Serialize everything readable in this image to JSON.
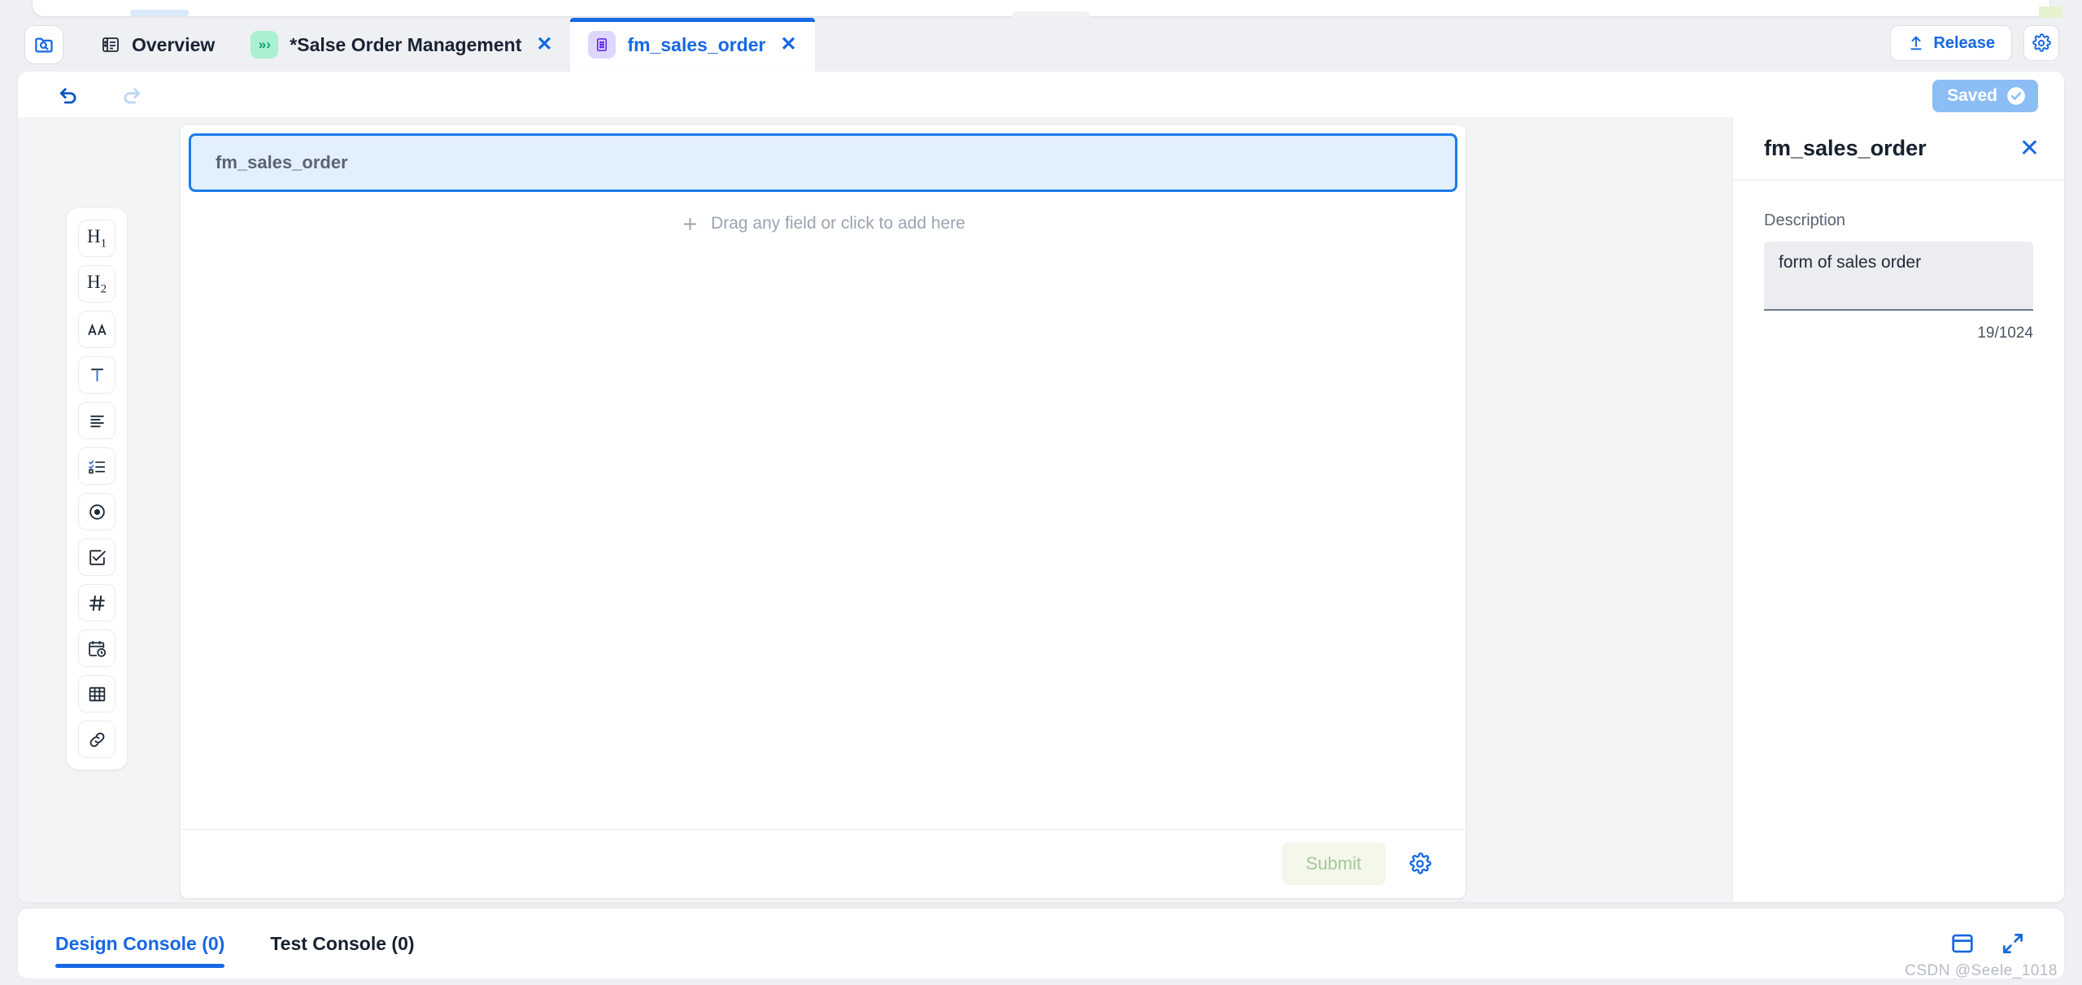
{
  "tabbar": {
    "home_icon": "folder-search-icon",
    "tabs": [
      {
        "label": "Overview",
        "icon": "document-list-icon",
        "active": false,
        "closable": false
      },
      {
        "label": "*Salse Order Management",
        "icon": "chevrons-right-icon",
        "active": false,
        "closable": true,
        "close_label": "✕"
      },
      {
        "label": "fm_sales_order",
        "icon": "form-icon",
        "active": true,
        "closable": true,
        "close_label": "✕"
      }
    ],
    "release_label": "Release",
    "settings_icon": "gear-icon"
  },
  "subtoolbar": {
    "undo_icon": "undo-arrow-icon",
    "redo_icon": "redo-arrow-icon",
    "saved_label": "Saved",
    "saved_check_icon": "check-circle-icon"
  },
  "widgets": [
    {
      "name": "heading-1",
      "kind": "h",
      "text": "H",
      "sub": "1"
    },
    {
      "name": "heading-2",
      "kind": "h",
      "text": "H",
      "sub": "2"
    },
    {
      "name": "font-style",
      "kind": "icon",
      "icon": "font-aa-icon"
    },
    {
      "name": "text-field",
      "kind": "icon",
      "icon": "text-t-icon"
    },
    {
      "name": "paragraph",
      "kind": "icon",
      "icon": "paragraph-lines-icon"
    },
    {
      "name": "checklist",
      "kind": "icon",
      "icon": "checklist-icon"
    },
    {
      "name": "radio-group",
      "kind": "icon",
      "icon": "radio-button-icon"
    },
    {
      "name": "checkbox",
      "kind": "icon",
      "icon": "checkbox-icon"
    },
    {
      "name": "number-field",
      "kind": "icon",
      "icon": "hash-number-icon"
    },
    {
      "name": "date-time",
      "kind": "icon",
      "icon": "calendar-clock-icon"
    },
    {
      "name": "table",
      "kind": "icon",
      "icon": "table-grid-icon"
    },
    {
      "name": "link",
      "kind": "icon",
      "icon": "link-chain-icon"
    }
  ],
  "form": {
    "header_title": "fm_sales_order",
    "dropzone_text": "Drag any field or click to add here",
    "dropzone_icon": "plus-icon",
    "submit_label": "Submit",
    "footer_settings_icon": "gear-icon"
  },
  "props": {
    "title": "fm_sales_order",
    "close_label": "✕",
    "description_label": "Description",
    "description_value": "form of sales order",
    "description_placeholder": "",
    "char_count": "19/1024"
  },
  "console": {
    "tabs": [
      {
        "label": "Design Console (0)",
        "active": true
      },
      {
        "label": "Test Console (0)",
        "active": false
      }
    ],
    "panel_icon": "panel-layout-icon",
    "expand_icon": "expand-fullscreen-icon"
  },
  "watermark": "CSDN @Seele_1018",
  "colors": {
    "accent": "#1668e3",
    "page_bg": "#eef0f3",
    "canvas_bg": "#f3f4f6",
    "header_fill": "#e2f0fd",
    "header_border": "#1a7bea",
    "saved_bg": "#8cbdf5",
    "submit_bg": "#f3f8ea",
    "submit_fg": "#a9c59c",
    "badge_green": "#aaf0d1",
    "badge_purple": "#ddd6fe"
  }
}
